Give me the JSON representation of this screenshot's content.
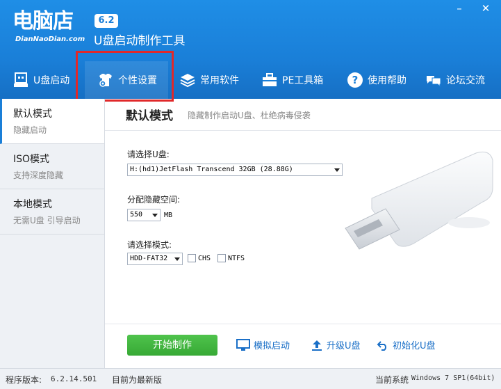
{
  "header": {
    "logo": "电脑店",
    "version": "6.2",
    "domain": "DianNaoDian.com",
    "tagline": "U盘启动制作工具",
    "min_symbol": "–",
    "close_symbol": "✕"
  },
  "nav": {
    "items": [
      {
        "label": "U盘启动",
        "icon": "usb-drive-icon"
      },
      {
        "label": "个性设置",
        "icon": "tshirt-gear-icon"
      },
      {
        "label": "常用软件",
        "icon": "layers-icon"
      },
      {
        "label": "PE工具箱",
        "icon": "toolbox-icon"
      },
      {
        "label": "使用帮助",
        "icon": "question-icon"
      },
      {
        "label": "论坛交流",
        "icon": "chat-icon"
      }
    ],
    "active_index": 1
  },
  "sidebar": {
    "items": [
      {
        "title": "默认模式",
        "desc": "隐藏启动"
      },
      {
        "title": "ISO模式",
        "desc": "支持深度隐藏"
      },
      {
        "title": "本地模式",
        "desc": "无需U盘 引导启动"
      }
    ],
    "active_index": 0
  },
  "main": {
    "title": "默认模式",
    "subtitle": "隐藏制作启动U盘、杜绝病毒侵袭",
    "usb_label": "请选择U盘:",
    "usb_value": "H:(hd1)JetFlash Transcend 32GB (28.88G)",
    "space_label": "分配隐藏空间:",
    "space_value": "550",
    "space_unit": "MB",
    "mode_label": "请选择模式:",
    "mode_value": "HDD-FAT32",
    "chs_label": "CHS",
    "ntfs_label": "NTFS",
    "chs_checked": false,
    "ntfs_checked": false
  },
  "actions": {
    "start": "开始制作",
    "simulate": "模拟启动",
    "upgrade": "升级U盘",
    "init": "初始化U盘"
  },
  "status": {
    "version_label": "程序版本:",
    "version_value": "6.2.14.501",
    "latest": "目前为最新版",
    "system_label": "当前系统",
    "system_value": "Windows 7 SP1(64bit)"
  },
  "colors": {
    "header_blue": "#1a7fd8",
    "highlight_red": "#e0282a",
    "start_green": "#3fb33d",
    "link_blue": "#1a6fc7"
  }
}
